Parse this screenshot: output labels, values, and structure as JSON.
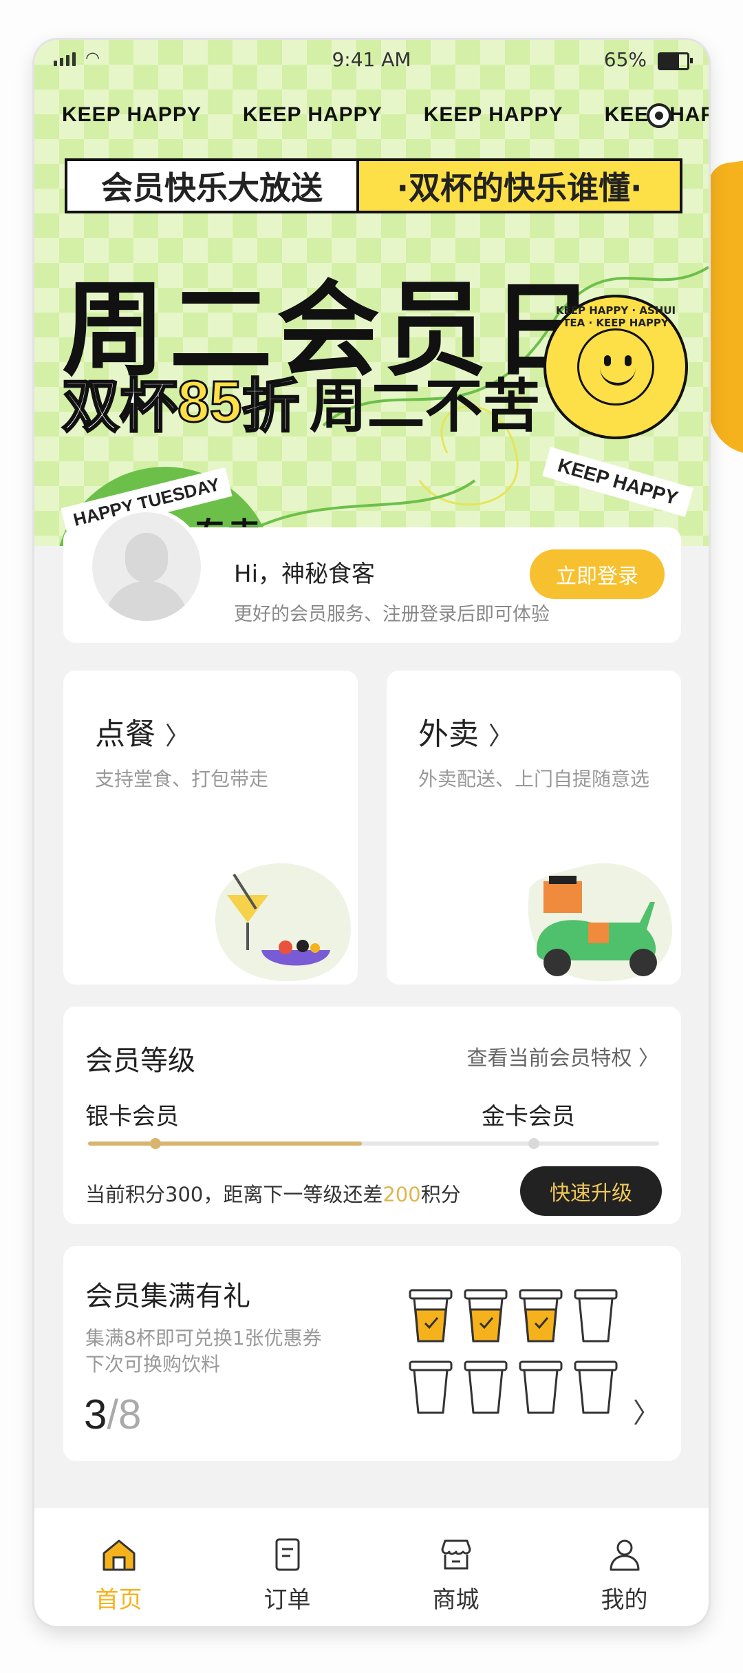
{
  "status": {
    "time": "9:41 AM",
    "battery": "65%"
  },
  "banner": {
    "marquee": [
      "KEEP HAPPY",
      "KEEP HAPPY",
      "KEEP HAPPY",
      "KEEP HAPP"
    ],
    "promo_left": "会员快乐大放送",
    "promo_right": "·双杯的快乐谁懂·",
    "title": "周二会员日",
    "sub_a": "双杯",
    "sub_b": "85",
    "sub_c": "折",
    "sub_d": "周二不苦",
    "badge_ring": "KEEP HAPPY · ASHUI TEA · KEEP HAPPY",
    "tag_right": "KEEP HAPPY",
    "tag_left": "HAPPY TUESDAY",
    "tag_left_cn": "专卖"
  },
  "user": {
    "greeting": "Hi，神秘食客",
    "hint": "更好的会员服务、注册登录后即可体验",
    "login_label": "立即登录"
  },
  "services": [
    {
      "title": "点餐",
      "desc": "支持堂食、打包带走"
    },
    {
      "title": "外卖",
      "desc": "外卖配送、上门自提随意选"
    }
  ],
  "level": {
    "title": "会员等级",
    "more": "查看当前会员特权",
    "current": "银卡会员",
    "next": "金卡会员",
    "progress": 0.48,
    "points_pre": "当前积分300，距离下一等级还差",
    "points_gap": "200",
    "points_post": "积分",
    "upgrade_label": "快速升级"
  },
  "stamp": {
    "title": "会员集满有礼",
    "desc1": "集满8杯即可兑换1张优惠券",
    "desc2": "下次可换购饮料",
    "count": "3",
    "sep": "/",
    "total": "8",
    "filled": 3,
    "cups": 8
  },
  "tabs": [
    {
      "label": "首页",
      "icon": "home-icon",
      "active": true
    },
    {
      "label": "订单",
      "icon": "order-icon",
      "active": false
    },
    {
      "label": "商城",
      "icon": "store-icon",
      "active": false
    },
    {
      "label": "我的",
      "icon": "profile-icon",
      "active": false
    }
  ],
  "colors": {
    "accent": "#f6b21c",
    "gold": "#d8b56c",
    "green": "#6cc04a",
    "yellow": "#fde047"
  }
}
